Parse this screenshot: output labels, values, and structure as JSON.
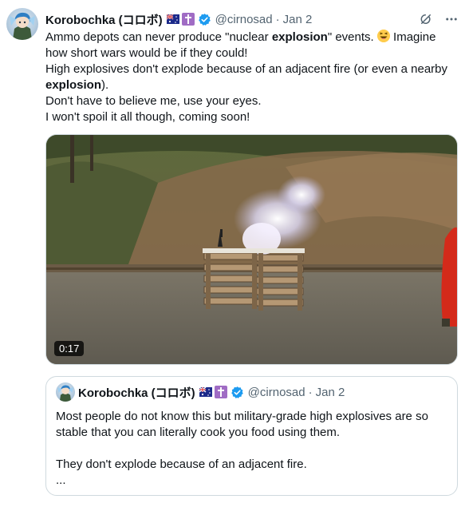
{
  "tweet": {
    "author_name": "Korobochka (コロボ)",
    "handle": "@cirnosad",
    "separator": "·",
    "date": "Jan 2",
    "text": {
      "l1a": "Ammo depots can never produce \"nuclear ",
      "l1b": "explosion",
      "l1c": "\" events. ",
      "l1d": " Imagine how short wars would be if they could!",
      "l2a": "High explosives don't explode because of an adjacent fire (or even a nearby ",
      "l2b": "explosion",
      "l2c": ").",
      "l3": "Don't have to believe me, use your eyes.",
      "l4": "I won't spoil it all though, coming soon!"
    },
    "video_duration": "0:17"
  },
  "quote": {
    "author_name": "Korobochka (コロボ)",
    "handle": "@cirnosad",
    "separator": "·",
    "date": "Jan 2",
    "p1": "Most people do not know this but military-grade high explosives are so stable that you can literally cook you food using them.",
    "p2": "They don't explode because of an adjacent fire.",
    "p3": "..."
  },
  "icons": {
    "verified": "verified-badge-icon",
    "grok": "grok-icon",
    "more": "more-icon",
    "flag": "australia-flag-icon",
    "cross": "cross-badge-icon",
    "emoji": "laughing-emoji-icon"
  },
  "colors": {
    "verified_blue": "#1d9bf0",
    "secondary_text": "#536471",
    "border": "#cfd9de"
  }
}
